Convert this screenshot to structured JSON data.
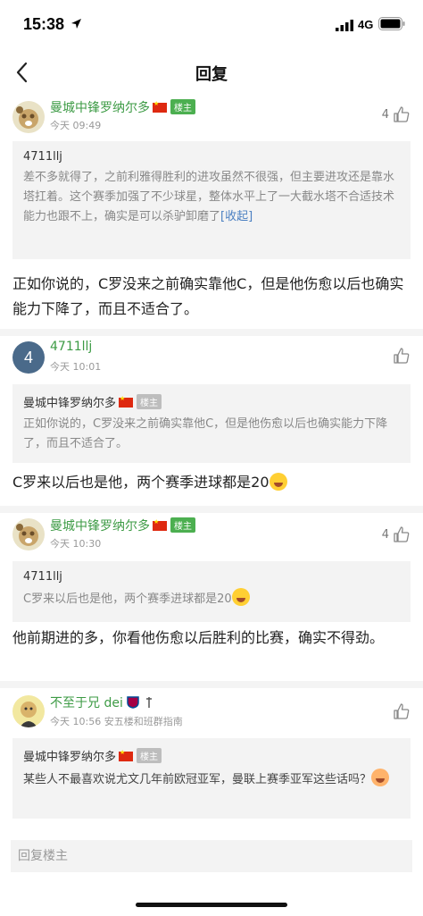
{
  "status_bar": {
    "time": "15:38",
    "network": "4G"
  },
  "nav": {
    "title": "回复"
  },
  "posts": [
    {
      "author": "曼城中锋罗纳尔多",
      "badge": "楼主",
      "time": "今天 09:49",
      "likes": "4",
      "quote": {
        "author": "4711llj",
        "text": "差不多就得了，之前利雅得胜利的进攻虽然不很强，但主要进攻还是靠水塔扛着。这个赛季加强了不少球星，整体水平上了一大截水塔不合适技术能力也跟不上，确实是可以杀驴卸磨了",
        "fold_label": "[收起]"
      },
      "body": "正如你说的，C罗没来之前确实靠他C，但是他伤愈以后也确实能力下降了，而且不适合了。"
    },
    {
      "author": "4711llj",
      "avatar_label": "4",
      "time": "今天 10:01",
      "likes": "",
      "quote": {
        "author": "曼城中锋罗纳尔多",
        "badge": "楼主",
        "text": "正如你说的，C罗没来之前确实靠他C，但是他伤愈以后也确实能力下降了，而且不适合了。"
      },
      "body": "C罗来以后也是他，两个赛季进球都是20"
    },
    {
      "author": "曼城中锋罗纳尔多",
      "badge": "楼主",
      "time": "今天 10:30",
      "likes": "4",
      "quote": {
        "author": "4711llj",
        "text": "C罗来以后也是他，两个赛季进球都是20"
      },
      "body": "他前期进的多，你看他伤愈以后胜利的比赛，确实不得劲。"
    },
    {
      "author": "不至于兄 dei",
      "time": "今天 10:56",
      "location": "安五楼和班群指南",
      "likes": "",
      "quote": {
        "author": "曼城中锋罗纳尔多",
        "badge": "楼主",
        "text": "某些人不最喜欢说尤文几年前欧冠亚军，曼联上赛季亚军这些话吗？"
      }
    }
  ],
  "reply_box": {
    "placeholder": "回复楼主"
  },
  "colors": {
    "author_green": "#3d9b45",
    "badge_green": "#4caf50",
    "link_blue": "#4a7fc1"
  }
}
